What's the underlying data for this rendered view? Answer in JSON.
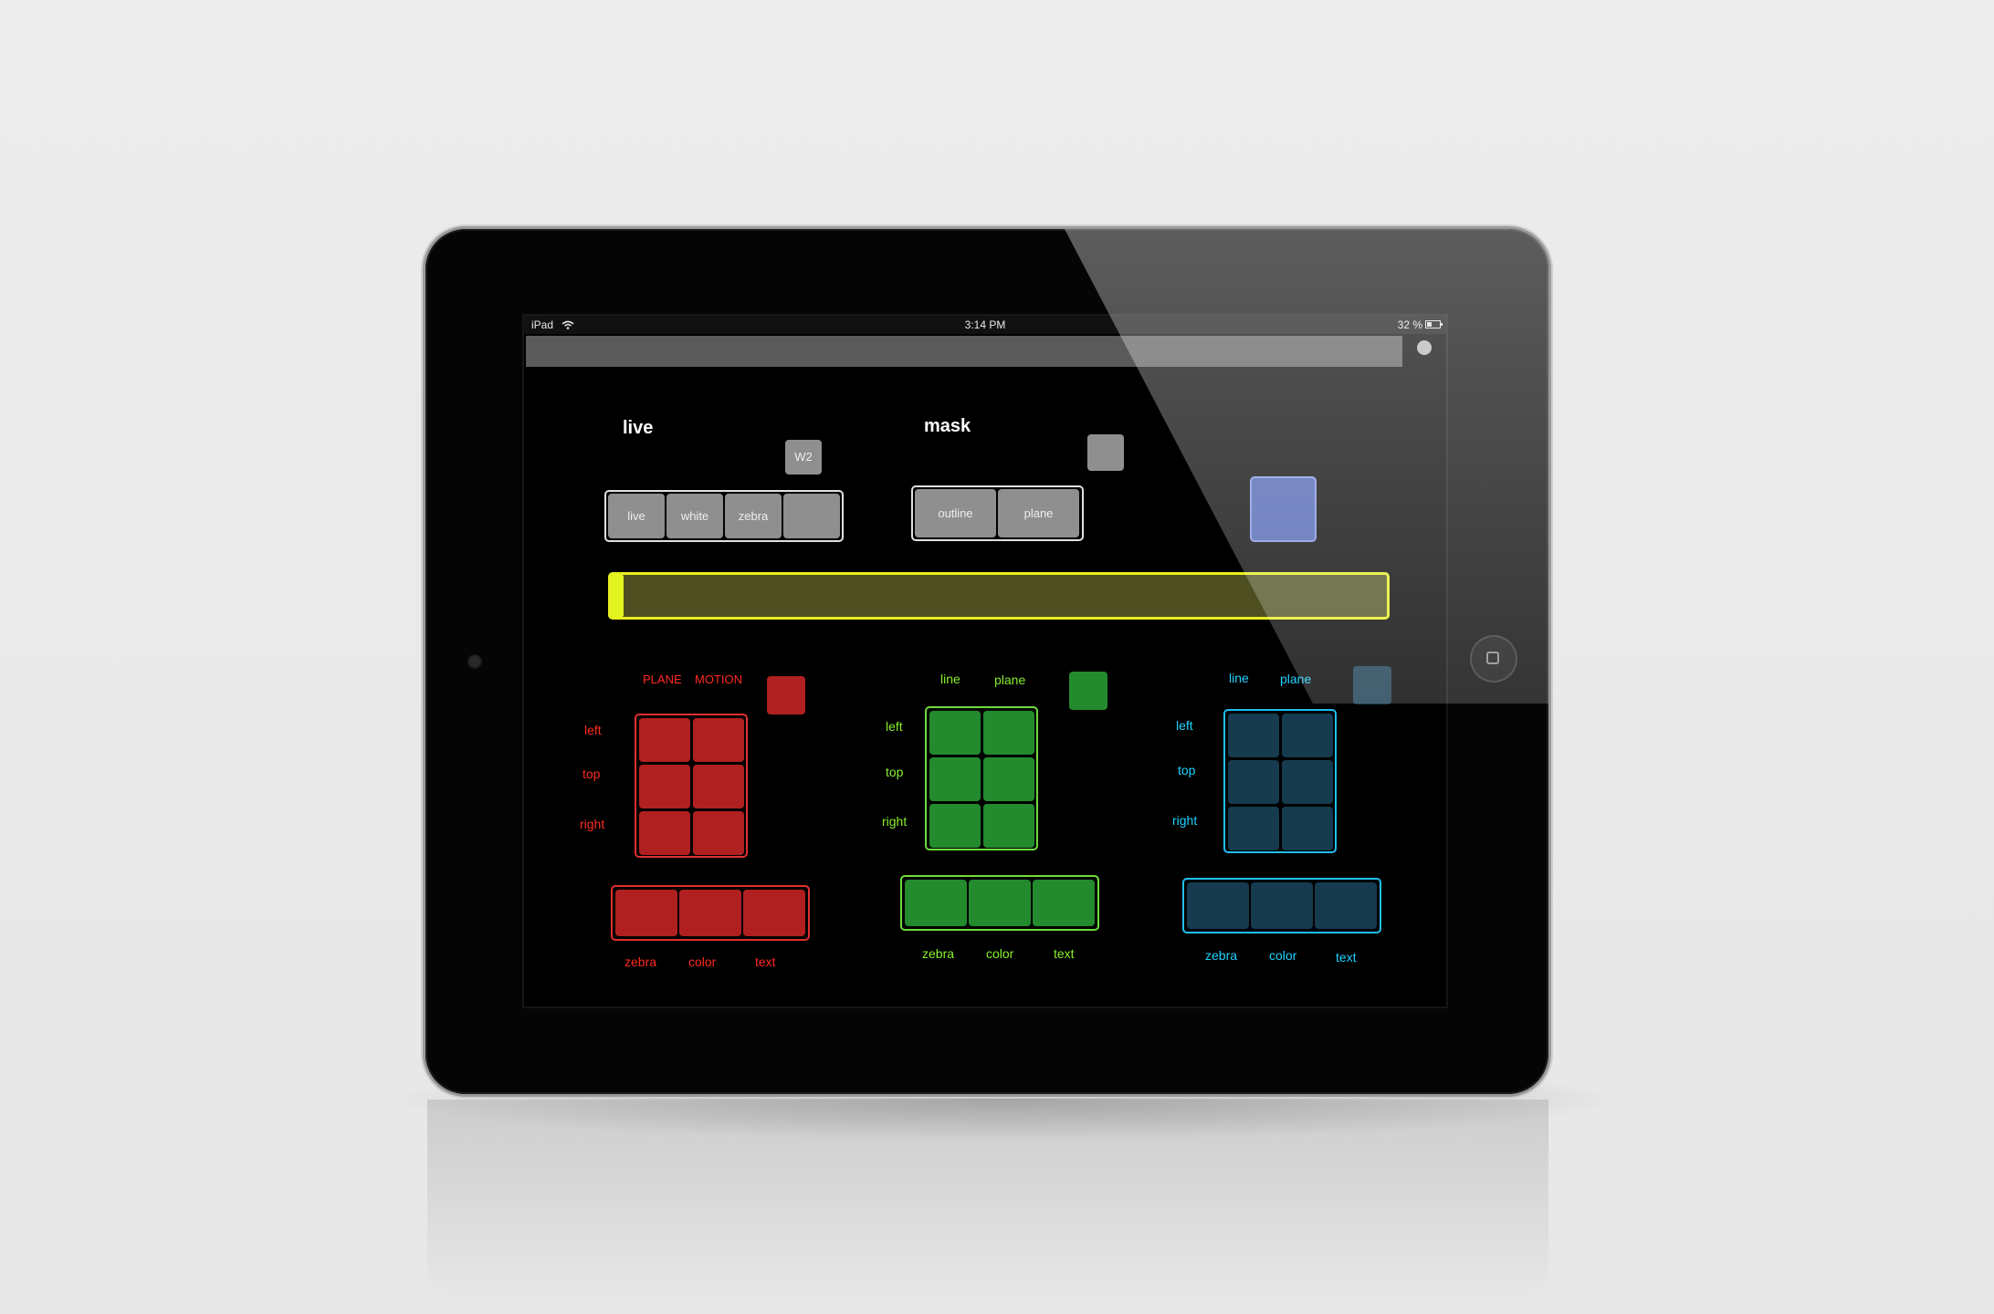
{
  "status_bar": {
    "device": "iPad",
    "time": "3:14 PM",
    "battery": "32 %"
  },
  "live_section": {
    "title": "live",
    "w_button": "W2",
    "buttons": [
      "live",
      "white",
      "zebra",
      ""
    ]
  },
  "mask_section": {
    "title": "mask",
    "buttons": [
      "outline",
      "plane"
    ]
  },
  "slider": {
    "value": 0.0
  },
  "red_panel": {
    "color": "#b02020",
    "header_left": "PLANE",
    "header_right": "MOTION",
    "row_labels": [
      "left",
      "top",
      "right"
    ],
    "bottom_labels": [
      "zebra",
      "color",
      "text"
    ]
  },
  "green_panel": {
    "color": "#238a2e",
    "header_left": "line",
    "header_right": "plane",
    "row_labels": [
      "left",
      "top",
      "right"
    ],
    "bottom_labels": [
      "zebra",
      "color",
      "text"
    ]
  },
  "blue_panel": {
    "color": "#163b4e",
    "header_left": "line",
    "header_right": "plane",
    "row_labels": [
      "left",
      "top",
      "right"
    ],
    "bottom_labels": [
      "zebra",
      "color",
      "text"
    ]
  },
  "colors": {
    "accent_yellow": "#e4f41e",
    "slider_fill": "#4e4f20",
    "blue_toggle": "#4a5fb0"
  }
}
